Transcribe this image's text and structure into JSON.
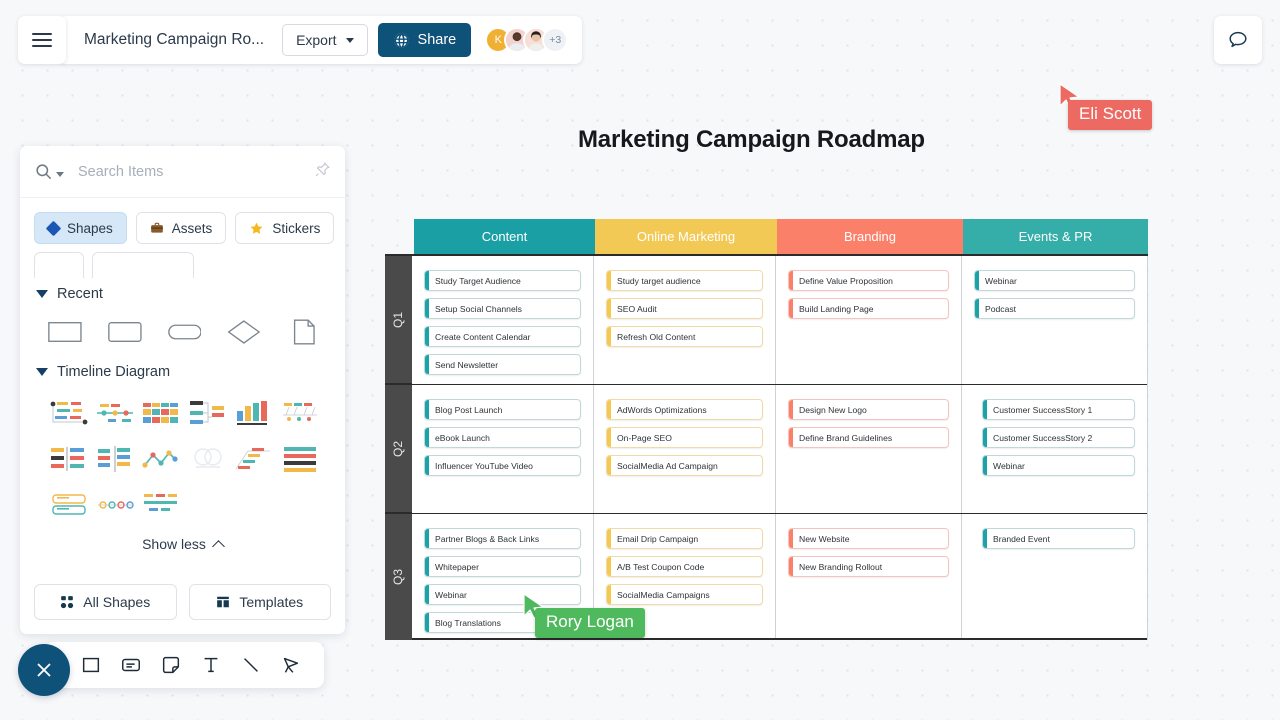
{
  "topbar": {
    "menu_icon": "hamburger-icon",
    "doc_title": "Marketing Campaign Ro...",
    "export_label": "Export",
    "share_label": "Share",
    "share_icon": "globe-icon",
    "avatars": [
      {
        "initial": "K",
        "type": "initial"
      },
      {
        "initial": "",
        "type": "photo"
      },
      {
        "initial": "",
        "type": "photo"
      }
    ],
    "avatar_overflow": "+3",
    "comment_icon": "comment-bubble-icon"
  },
  "panel": {
    "search_placeholder": "Search Items",
    "search_value": "",
    "search_icon": "search-icon",
    "pin_icon": "pin-icon",
    "tabs": [
      {
        "label": "Shapes",
        "icon": "diamond-icon",
        "active": true
      },
      {
        "label": "Assets",
        "icon": "briefcase-icon",
        "active": false
      },
      {
        "label": "Stickers",
        "icon": "star-icon",
        "active": false
      }
    ],
    "sections": [
      {
        "title": "Recent"
      },
      {
        "title": "Timeline Diagram"
      }
    ],
    "recent_shapes": [
      "rectangle",
      "rounded-rectangle",
      "pill",
      "diamond",
      "document"
    ],
    "show_less_label": "Show less",
    "show_less_icon": "chevron-up-icon",
    "footer": [
      {
        "label": "All Shapes",
        "icon": "grid-dots-icon"
      },
      {
        "label": "Templates",
        "icon": "template-icon"
      }
    ]
  },
  "toolbar": {
    "close_icon": "close-x-icon",
    "tools": [
      {
        "name": "shape-tool",
        "icon": "square-icon"
      },
      {
        "name": "card-tool",
        "icon": "card-icon"
      },
      {
        "name": "note-tool",
        "icon": "sticky-note-icon"
      },
      {
        "name": "text-tool",
        "icon": "text-t-icon"
      },
      {
        "name": "line-tool",
        "icon": "line-icon"
      },
      {
        "name": "pen-tool",
        "icon": "pen-nib-icon"
      }
    ]
  },
  "board": {
    "title": "Marketing Campaign Roadmap",
    "columns": [
      {
        "label": "Content",
        "color": "#1a9fa5",
        "accent": "teal"
      },
      {
        "label": "Online Marketing",
        "color": "#f3c956",
        "accent": "yellow"
      },
      {
        "label": "Branding",
        "color": "#fb8069",
        "accent": "coral"
      },
      {
        "label": "Events & PR",
        "color": "#35ada8",
        "accent": "teal"
      }
    ],
    "rows": [
      {
        "label": "Q1",
        "cells": [
          [
            "Study Target Audience",
            "Setup Social Channels",
            "Create Content Calendar",
            "Send Newsletter"
          ],
          [
            "Study target audience",
            "SEO Audit",
            "Refresh Old Content"
          ],
          [
            "Define Value Proposition",
            "Build Landing Page"
          ],
          [
            "Webinar",
            "Podcast"
          ]
        ]
      },
      {
        "label": "Q2",
        "cells": [
          [
            "Blog Post Launch",
            "eBook Launch",
            "Influencer YouTube Video"
          ],
          [
            "AdWords Optimizations",
            "On-Page SEO",
            "SocialMedia Ad Campaign"
          ],
          [
            "Design New Logo",
            "Define Brand Guidelines"
          ],
          [
            "Customer SuccessStory 1",
            "Customer SuccessStory 2",
            "Webinar"
          ]
        ]
      },
      {
        "label": "Q3",
        "cells": [
          [
            "Partner Blogs & Back Links",
            "Whitepaper",
            "Webinar",
            "Blog Translations"
          ],
          [
            "Email Drip Campaign",
            "A/B Test Coupon Code",
            "SocialMedia Campaigns"
          ],
          [
            "New Website",
            "New Branding Rollout"
          ],
          [
            "Branded Event"
          ]
        ]
      }
    ]
  },
  "cursors": [
    {
      "name": "Eli Scott",
      "color": "#ec6a62"
    },
    {
      "name": "Rory Logan",
      "color": "#4fb95e"
    }
  ]
}
